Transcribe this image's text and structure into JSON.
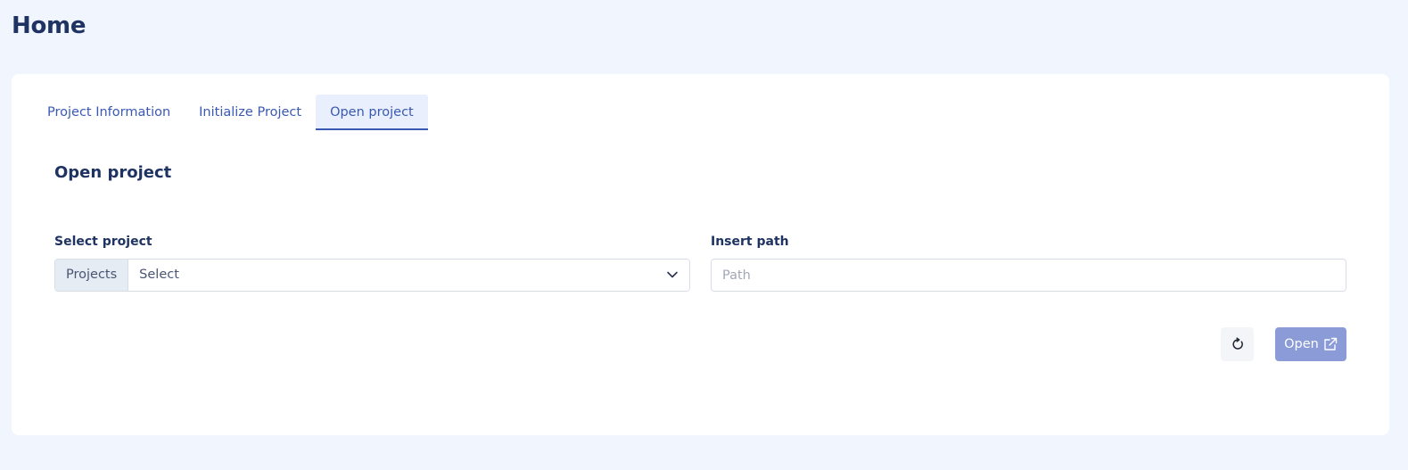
{
  "page": {
    "title": "Home"
  },
  "tabs": [
    {
      "label": "Project Information",
      "active": false
    },
    {
      "label": "Initialize Project",
      "active": false
    },
    {
      "label": "Open project",
      "active": true
    }
  ],
  "section": {
    "title": "Open project"
  },
  "select_project": {
    "label": "Select project",
    "addon": "Projects",
    "value": "Select",
    "icon": "chevron-down-icon"
  },
  "insert_path": {
    "label": "Insert path",
    "placeholder": "Path",
    "value": ""
  },
  "actions": {
    "refresh_icon": "refresh-icon",
    "open_label": "Open",
    "open_icon": "external-link-icon"
  },
  "colors": {
    "background": "#f0f5fe",
    "card": "#ffffff",
    "heading": "#1f3363",
    "accent": "#3a59b3",
    "active_tab_bg": "#e9effc",
    "open_button": "#8a9bd8"
  }
}
